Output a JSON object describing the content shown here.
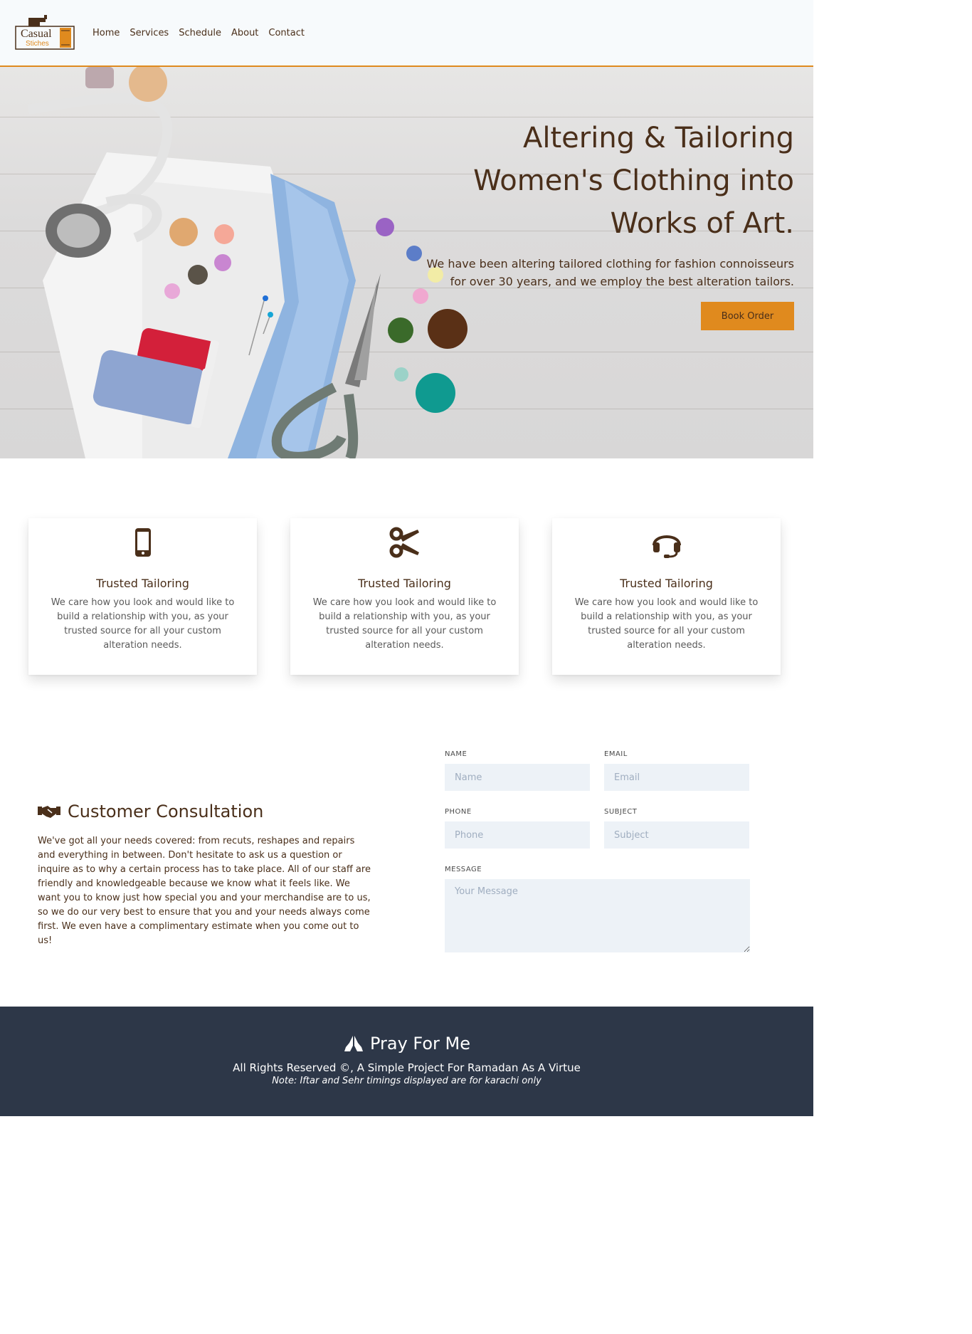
{
  "nav": {
    "logo": {
      "main": "Casual",
      "sub": "Stiches"
    },
    "links": [
      "Home",
      "Services",
      "Schedule",
      "About",
      "Contact"
    ]
  },
  "hero": {
    "title_lines": [
      "Altering & Tailoring",
      "Women's Clothing into",
      "Works of Art."
    ],
    "subtitle": "We have been altering tailored clothing for fashion connoisseurs for over 30 years, and we employ the best alteration tailors.",
    "button": "Book Order"
  },
  "features": [
    {
      "icon": "mobile-phone-icon",
      "title": "Trusted Tailoring",
      "text": "We care how you look and would like to build a relationship with you, as your trusted source for all your custom alteration needs."
    },
    {
      "icon": "scissors-icon",
      "title": "Trusted Tailoring",
      "text": "We care how you look and would like to build a relationship with you, as your trusted source for all your custom alteration needs."
    },
    {
      "icon": "headset-icon",
      "title": "Trusted Tailoring",
      "text": "We care how you look and would like to build a relationship with you, as your trusted source for all your custom alteration needs."
    }
  ],
  "consultation": {
    "icon": "handshake-icon",
    "title": "Customer Consultation",
    "text": "We've got all your needs covered: from recuts, reshapes and repairs and everything in between. Don't hesitate to ask us a question or inquire as to why a certain process has to take place. All of our staff are friendly and knowledgeable because we know what it feels like. We want you to know just how special you and your merchandise are to us, so we do our very best to ensure that you and your needs always come first. We even have a complimentary estimate when you come out to us!"
  },
  "form": {
    "name": {
      "label": "NAME",
      "placeholder": "Name"
    },
    "email": {
      "label": "EMAIL",
      "placeholder": "Email"
    },
    "phone": {
      "label": "PHONE",
      "placeholder": "Phone"
    },
    "subject": {
      "label": "SUBJECT",
      "placeholder": "Subject"
    },
    "message": {
      "label": "MESSAGE",
      "placeholder": "Your Message"
    }
  },
  "footer": {
    "icon": "praying-hands-icon",
    "title": "Pray For Me",
    "copyright": "All Rights Reserved ©, A Simple Project For Ramadan As A Virtue",
    "note": "Note: Iftar and Sehr timings displayed are for karachi only"
  },
  "colors": {
    "accent": "#e08a1e",
    "brown": "#4a2f1a",
    "footer_bg": "#2d3748",
    "input_bg": "#edf2f7"
  }
}
